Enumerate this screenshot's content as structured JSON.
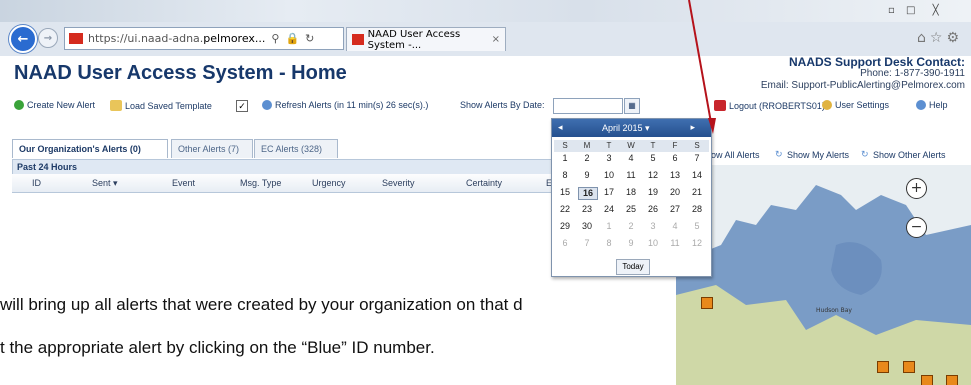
{
  "browser": {
    "url_prefix": "https://ui.naad-adna.",
    "url_domain": "pelmorex...",
    "tab_title": "NAAD User Access System -...",
    "tab_close": "×"
  },
  "header": {
    "title": "NAAD User Access System - Home",
    "support_title": "NAADS Support Desk Contact:",
    "phone": "Phone: 1-877-390-1911",
    "email": "Email: Support-PublicAlerting@Pelmorex.com"
  },
  "toolbar": {
    "create_new_alert": "Create New Alert",
    "load_saved_template": "Load Saved Template",
    "refresh_alerts": "Refresh Alerts (in 11 min(s) 26 sec(s).)",
    "show_alerts_by_date": "Show Alerts By Date:",
    "logout": "Logout (RROBERTS01)",
    "user_settings": "User Settings",
    "help": "Help"
  },
  "tabs": [
    {
      "label": "Our Organization's Alerts (0)"
    },
    {
      "label": "Other Alerts (7)"
    },
    {
      "label": "EC Alerts (328)"
    }
  ],
  "section": {
    "title": "Past 24 Hours"
  },
  "grid": {
    "columns": [
      "ID",
      "Sent ▾",
      "Event",
      "Msg. Type",
      "Urgency",
      "Severity",
      "Certainty",
      "E"
    ]
  },
  "calendar": {
    "month_label": "April 2015 ▾",
    "prev": "◂",
    "next": "▸",
    "days_of_week": [
      "S",
      "M",
      "T",
      "W",
      "T",
      "F",
      "S"
    ],
    "weeks": [
      [
        "1",
        "2",
        "3",
        "4",
        "5",
        "6",
        "7"
      ],
      [
        "8",
        "9",
        "10",
        "11",
        "12",
        "13",
        "14"
      ],
      [
        "15",
        "16",
        "17",
        "18",
        "19",
        "20",
        "21"
      ],
      [
        "22",
        "23",
        "24",
        "25",
        "26",
        "27",
        "28"
      ],
      [
        "29",
        "30",
        "1",
        "2",
        "3",
        "4",
        "5"
      ],
      [
        "6",
        "7",
        "8",
        "9",
        "10",
        "11",
        "12"
      ]
    ],
    "selected": "16",
    "today_label": "Today"
  },
  "right_toolbar": {
    "show_all": "ow All Alerts",
    "show_my": "Show My Alerts",
    "show_other": "Show Other Alerts"
  },
  "map": {
    "zoom_in": "+",
    "zoom_out": "−",
    "label": "Hudson Bay"
  },
  "caption": {
    "line1_a": "will bring up all alerts that were created by your ",
    "line1_b": "organization",
    "line1_c": " on that d",
    "line2": "t the appropriate alert by clicking on the “Blue” ID number."
  },
  "colors": {
    "title": "#17386b",
    "arrow": "#b5121b",
    "map_water": "#7a9cc6",
    "pin": "#e8891b"
  }
}
